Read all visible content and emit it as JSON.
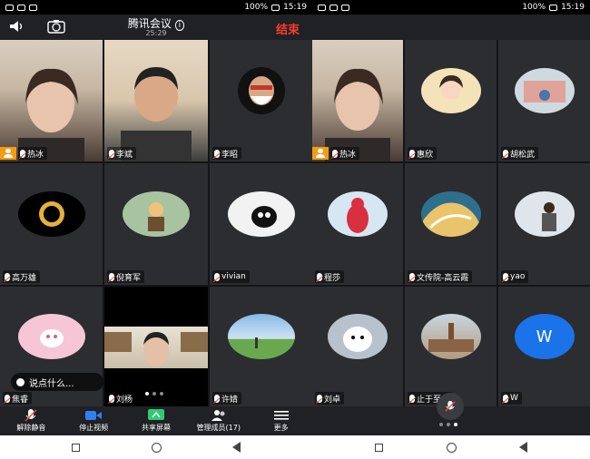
{
  "status": {
    "time": "15:19",
    "battery": "100%"
  },
  "meeting": {
    "title": "腾讯会议",
    "duration": "25:29",
    "end_label": "结束"
  },
  "left_tiles": [
    {
      "name": "热冰"
    },
    {
      "name": "李斌"
    },
    {
      "name": "李昭"
    },
    {
      "name": "高万雄"
    },
    {
      "name": "倪育军"
    },
    {
      "name": "vivian"
    },
    {
      "name": "焦睿"
    },
    {
      "name": "刘杨"
    },
    {
      "name": "许婧"
    }
  ],
  "right_tiles": [
    {
      "name": "热冰"
    },
    {
      "name": "惠欣"
    },
    {
      "name": "胡松武"
    },
    {
      "name": "程莎"
    },
    {
      "name": "文传院-高云霞"
    },
    {
      "name": "yao"
    },
    {
      "name": "刘卓"
    },
    {
      "name": "止于至善"
    },
    {
      "name": "W",
      "avatar_letter": "W"
    }
  ],
  "chat": {
    "placeholder": "说点什么..."
  },
  "toolbar": {
    "unmute": "解除静音",
    "stop_video": "停止视频",
    "share_screen": "共享屏幕",
    "manage_members": "管理成员(17)",
    "more": "更多"
  },
  "colors": {
    "end": "#ff3b30",
    "host": "#f39c12",
    "w_avatar": "#1a73e8",
    "share": "#2ecc71",
    "video": "#2f7ff5"
  }
}
